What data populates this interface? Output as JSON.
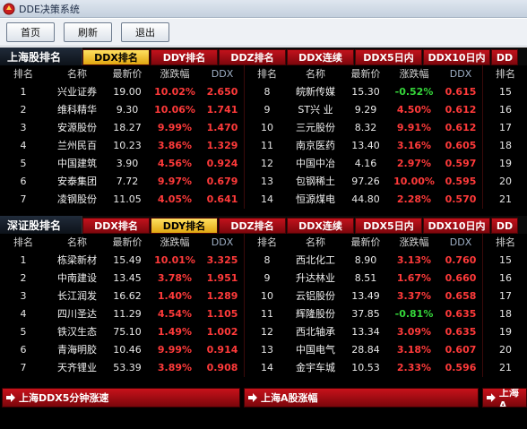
{
  "window": {
    "title": "DDE决策系统"
  },
  "toolbar": {
    "home": "首页",
    "refresh": "刷新",
    "exit": "退出"
  },
  "header_cols": [
    "排名",
    "名称",
    "最新价",
    "涨跌幅",
    "DDX",
    "排名",
    "名称",
    "最新价",
    "涨跌幅",
    "DDX",
    "排名"
  ],
  "sh": {
    "title": "上海股排名",
    "tabs": [
      "DDX排名",
      "DDY排名",
      "DDZ排名",
      "DDX连续",
      "DDX5日内",
      "DDX10日内",
      "DD"
    ],
    "active_tab": 0,
    "left": [
      [
        "1",
        "兴业证券",
        "19.00",
        "10.02%",
        "2.650"
      ],
      [
        "2",
        "维科精华",
        "9.30",
        "10.06%",
        "1.741"
      ],
      [
        "3",
        "安源股份",
        "18.27",
        "9.99%",
        "1.470"
      ],
      [
        "4",
        "兰州民百",
        "10.23",
        "3.86%",
        "1.329"
      ],
      [
        "5",
        "中国建筑",
        "3.90",
        "4.56%",
        "0.924"
      ],
      [
        "6",
        "安泰集团",
        "7.72",
        "9.97%",
        "0.679"
      ],
      [
        "7",
        "凌钢股份",
        "11.05",
        "4.05%",
        "0.641"
      ]
    ],
    "right": [
      [
        "8",
        "皖新传媒",
        "15.30",
        "-0.52%",
        "0.615"
      ],
      [
        "9",
        "ST兴 业",
        "9.29",
        "4.50%",
        "0.612"
      ],
      [
        "10",
        "三元股份",
        "8.32",
        "9.91%",
        "0.612"
      ],
      [
        "11",
        "南京医药",
        "13.40",
        "3.16%",
        "0.605"
      ],
      [
        "12",
        "中国中冶",
        "4.16",
        "2.97%",
        "0.597"
      ],
      [
        "13",
        "包钢稀土",
        "97.26",
        "10.00%",
        "0.595"
      ],
      [
        "14",
        "恒源煤电",
        "44.80",
        "2.28%",
        "0.570"
      ]
    ],
    "third": [
      "15",
      "16",
      "17",
      "18",
      "19",
      "20",
      "21"
    ]
  },
  "sz": {
    "title": "深证股排名",
    "tabs": [
      "DDX排名",
      "DDY排名",
      "DDZ排名",
      "DDX连续",
      "DDX5日内",
      "DDX10日内",
      "DD"
    ],
    "active_tab": 1,
    "left": [
      [
        "1",
        "栋梁新材",
        "15.49",
        "10.01%",
        "3.325"
      ],
      [
        "2",
        "中南建设",
        "13.45",
        "3.78%",
        "1.951"
      ],
      [
        "3",
        "长江润发",
        "16.62",
        "1.40%",
        "1.289"
      ],
      [
        "4",
        "四川圣达",
        "11.29",
        "4.54%",
        "1.105"
      ],
      [
        "5",
        "铁汉生态",
        "75.10",
        "1.49%",
        "1.002"
      ],
      [
        "6",
        "青海明胶",
        "10.46",
        "9.99%",
        "0.914"
      ],
      [
        "7",
        "天齐锂业",
        "53.39",
        "3.89%",
        "0.908"
      ]
    ],
    "right": [
      [
        "8",
        "西北化工",
        "8.90",
        "3.13%",
        "0.760"
      ],
      [
        "9",
        "升达林业",
        "8.51",
        "1.67%",
        "0.660"
      ],
      [
        "10",
        "云铝股份",
        "13.49",
        "3.37%",
        "0.658"
      ],
      [
        "11",
        "辉隆股份",
        "37.85",
        "-0.81%",
        "0.635"
      ],
      [
        "12",
        "西北轴承",
        "13.34",
        "3.09%",
        "0.635"
      ],
      [
        "13",
        "中国电气",
        "28.84",
        "3.18%",
        "0.607"
      ],
      [
        "14",
        "金宇车城",
        "10.53",
        "2.33%",
        "0.596"
      ]
    ],
    "third": [
      "15",
      "16",
      "17",
      "18",
      "19",
      "20",
      "21"
    ]
  },
  "bottom": {
    "panels": [
      "上海DDX5分钟涨速",
      "上海A股涨幅",
      "上海A"
    ]
  },
  "colors": {
    "up": "#ff3a3a",
    "down": "#35d63a",
    "active_tab": "#f2c53a",
    "tab": "#a70d15"
  }
}
